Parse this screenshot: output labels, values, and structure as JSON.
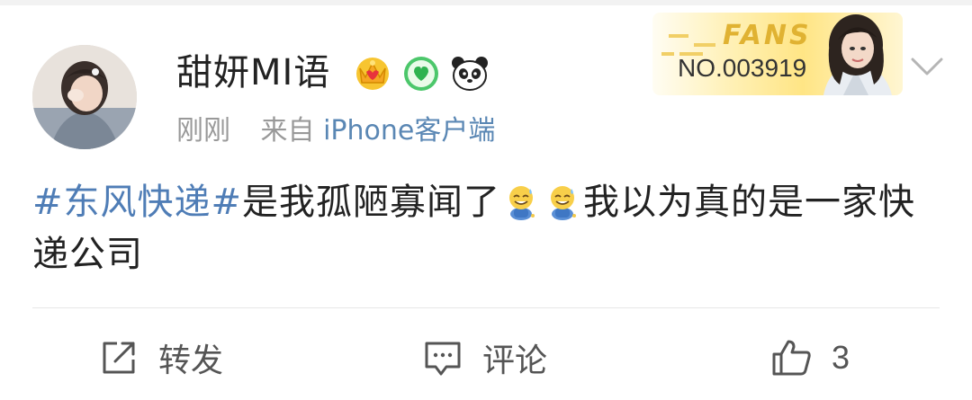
{
  "user": {
    "name": "甜妍MI语",
    "badges": [
      "crown-badge-icon",
      "green-heart-badge-icon",
      "panda-badge-icon"
    ]
  },
  "meta": {
    "time": "刚刚",
    "source_prefix": "来自",
    "client": "iPhone客户端"
  },
  "fans_card": {
    "title": "FANS",
    "number": "NO.003919"
  },
  "post": {
    "hashtag": "#东风快递#",
    "text_before_emoji": "是我孤陋寡闻了",
    "emojis": [
      "sweat-smile-emoji-icon",
      "sweat-smile-emoji-icon"
    ],
    "text_after_emoji": "我以为真的是一家快递公司"
  },
  "actions": {
    "forward_label": "转发",
    "comment_label": "评论",
    "like_count": "3"
  },
  "colors": {
    "hashtag": "#4f7db6",
    "client_link": "#5a87b4",
    "meta_text": "#999999",
    "fans_gold": "#e0b232"
  }
}
